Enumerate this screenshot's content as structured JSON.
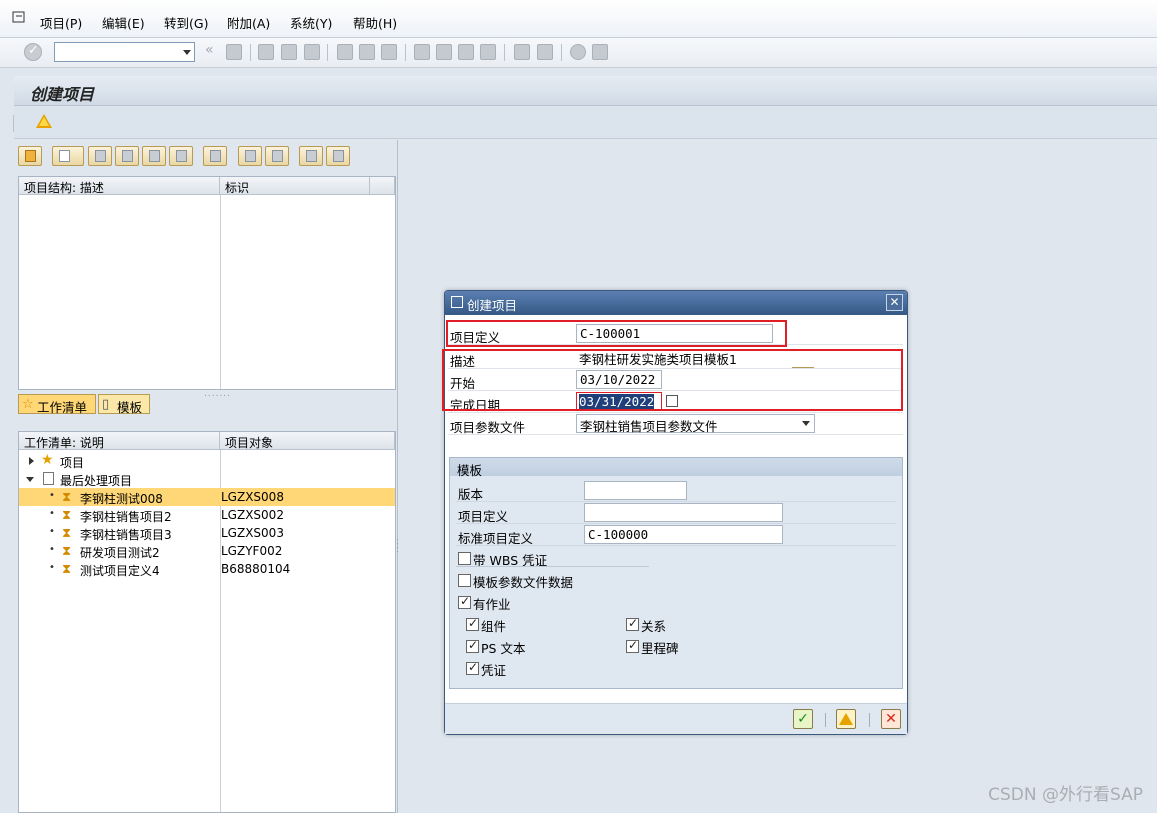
{
  "menubar": {
    "items": [
      "项目(P)",
      "编辑(E)",
      "转到(G)",
      "附加(A)",
      "系统(Y)",
      "帮助(H)"
    ]
  },
  "toolbar": {
    "command_value": ""
  },
  "screen": {
    "title": "创建项目"
  },
  "tree": {
    "headers": [
      "项目结构: 描述",
      "标识"
    ]
  },
  "tabs": [
    "工作清单",
    "模板"
  ],
  "worklist": {
    "headers": [
      "工作清单: 说明",
      "项目对象"
    ],
    "nodes": [
      {
        "label": "项目",
        "object": ""
      },
      {
        "label": "最后处理项目",
        "object": ""
      },
      {
        "label": "李钢柱测试008",
        "object": "LGZXS008"
      },
      {
        "label": "李钢柱销售项目2",
        "object": "LGZXS002"
      },
      {
        "label": "李钢柱销售项目3",
        "object": "LGZXS003"
      },
      {
        "label": "研发项目测试2",
        "object": "LGZYF002"
      },
      {
        "label": "测试项目定义4",
        "object": "B68880104"
      }
    ]
  },
  "dialog": {
    "title": "创建项目",
    "fields": {
      "project_def": {
        "label": "项目定义",
        "value": "C-100001"
      },
      "description": {
        "label": "描述",
        "value": "李钢柱研发实施类项目模板1"
      },
      "start": {
        "label": "开始",
        "value": "03/10/2022"
      },
      "finish": {
        "label": "完成日期",
        "value": "03/31/2022"
      },
      "profile": {
        "label": "项目参数文件",
        "value": "李钢柱销售项目参数文件"
      }
    },
    "template": {
      "title": "模板",
      "version_label": "版本",
      "version_value": "",
      "project_def_label": "项目定义",
      "project_def_value": "",
      "std_project_label": "标准项目定义",
      "std_project_value": "C-100000",
      "cb_wbs": "带 WBS 凭证",
      "cb_profile_data": "模板参数文件数据",
      "cb_activities": "有作业",
      "cb_components": "组件",
      "cb_relations": "关系",
      "cb_ps_text": "PS 文本",
      "cb_milestones": "里程碑",
      "cb_documents": "凭证"
    }
  },
  "watermark": "CSDN @外行看SAP",
  "colors": {
    "highlight_box": "#e01e25",
    "selected_row": "#ffd776",
    "dialog_title": "#355985"
  }
}
